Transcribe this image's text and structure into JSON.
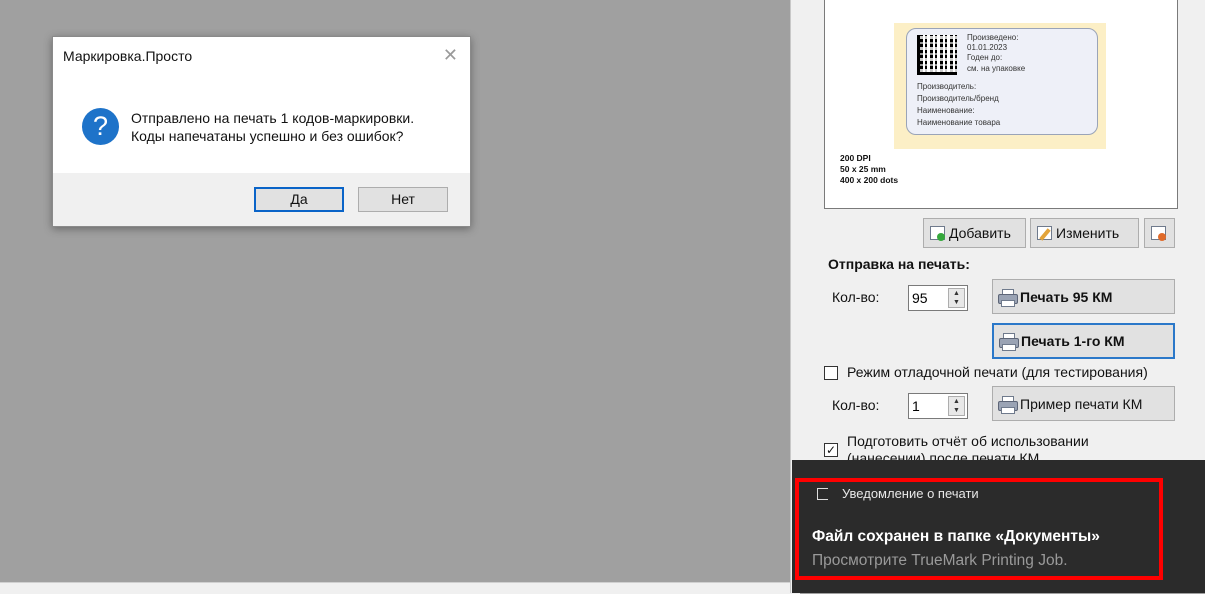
{
  "dialog": {
    "title": "Маркировка.Просто",
    "message_line1": "Отправлено на печать 1 кодов-маркировки.",
    "message_line2": "Коды напечатаны успешно и без ошибок?",
    "yes_label": "Да",
    "no_label": "Нет",
    "close_glyph": "✕",
    "icon": "question-icon"
  },
  "preview": {
    "produced_label": "Произведено:",
    "produced_value": "01.01.2023",
    "expiry_label": "Годен до:",
    "expiry_value": "см. на упаковке",
    "manufacturer_label": "Производитель:",
    "manufacturer_value": "Производитель/бренд",
    "name_label": "Наименование:",
    "name_value": "Наименование товара",
    "dpi": "200 DPI",
    "size_mm": "50 x 25 mm",
    "size_dots": "400 x 200 dots"
  },
  "template_buttons": {
    "add_label": "Добавить",
    "edit_label": "Изменить"
  },
  "print": {
    "section_title": "Отправка на печать:",
    "qty_label": "Кол-во:",
    "qty_value": "95",
    "print_all_label": "Печать 95 КМ",
    "print_one_label": "Печать 1-го КМ",
    "debug_mode_label": "Режим отладочной печати (для тестирования)",
    "debug_mode_checked": false,
    "debug_qty_label": "Кол-во:",
    "debug_qty_value": "1",
    "sample_print_label": "Пример печати КМ",
    "report_line1": "Подготовить отчёт об использовании",
    "report_line2": "(нанесении) после печати КМ",
    "report_checked": true
  },
  "toast": {
    "app_name": "Уведомление о печати",
    "title": "Файл сохранен в папке «Документы»",
    "body": "Просмотрите TrueMark Printing Job."
  },
  "colors": {
    "highlight_border": "#ff0000",
    "toast_bg": "#2b2b2b",
    "accent": "#1e73c9"
  }
}
